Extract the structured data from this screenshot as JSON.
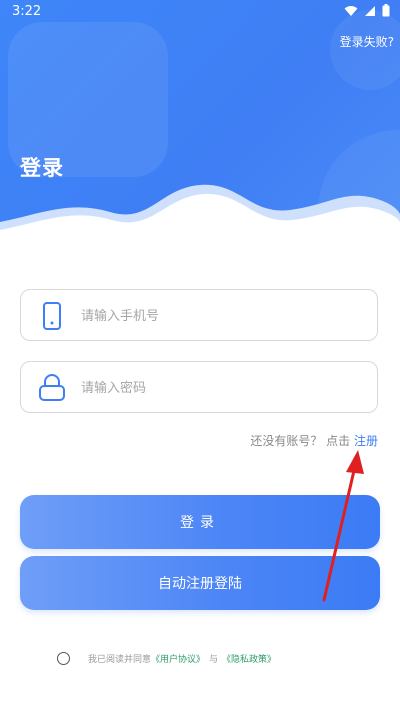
{
  "status_bar": {
    "time": "3:22"
  },
  "header": {
    "login_fail_link": "登录失败?",
    "title": "登录"
  },
  "form": {
    "phone": {
      "placeholder": "请输入手机号",
      "icon": "phone-icon"
    },
    "password": {
      "placeholder": "请输入密码",
      "icon": "lock-icon"
    },
    "register_prompt": "还没有账号？ 点击",
    "register_link": "注册"
  },
  "buttons": {
    "login_label": "登录",
    "auto_register_label": "自动注册登陆"
  },
  "agreement": {
    "prefix": "我已阅读并同意",
    "user_agreement": "《用户协议》",
    "and": "与",
    "privacy_policy": "《隐私政策》",
    "checked": false
  },
  "colors": {
    "primary": "#3f7ef4",
    "button_gradient_start": "#6f9ef8",
    "button_gradient_end": "#3b7bf5",
    "agreement_link": "#2e9b6d",
    "annotation_arrow": "#e02020"
  }
}
